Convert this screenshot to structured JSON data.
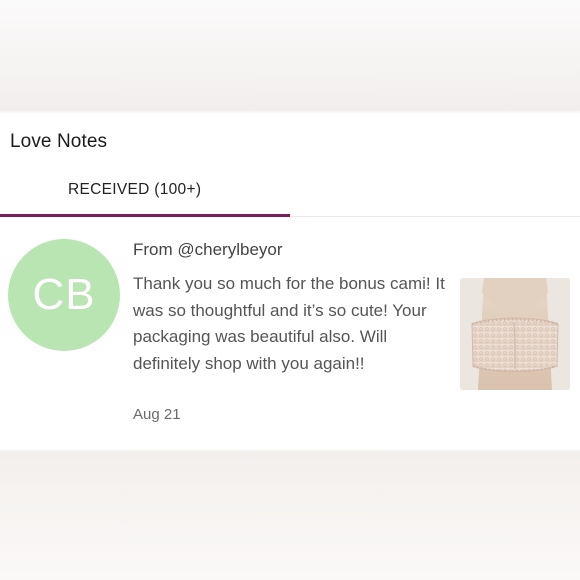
{
  "header": {
    "title": "Love Notes"
  },
  "tabs": {
    "received_label": "RECEIVED (100+)"
  },
  "note": {
    "avatar_initials": "CB",
    "from": "From @cherylbeyor",
    "message": "Thank you so much for the bonus cami! It was so thoughtful and it’s so cute! Your packaging was beautiful also. Will definitely shop with you again!!",
    "date": "Aug 21"
  },
  "colors": {
    "accent": "#7a1f5c",
    "avatar_bg": "#b8e5b1"
  },
  "icons": {
    "product_image": "lace-bandeau-photo"
  }
}
